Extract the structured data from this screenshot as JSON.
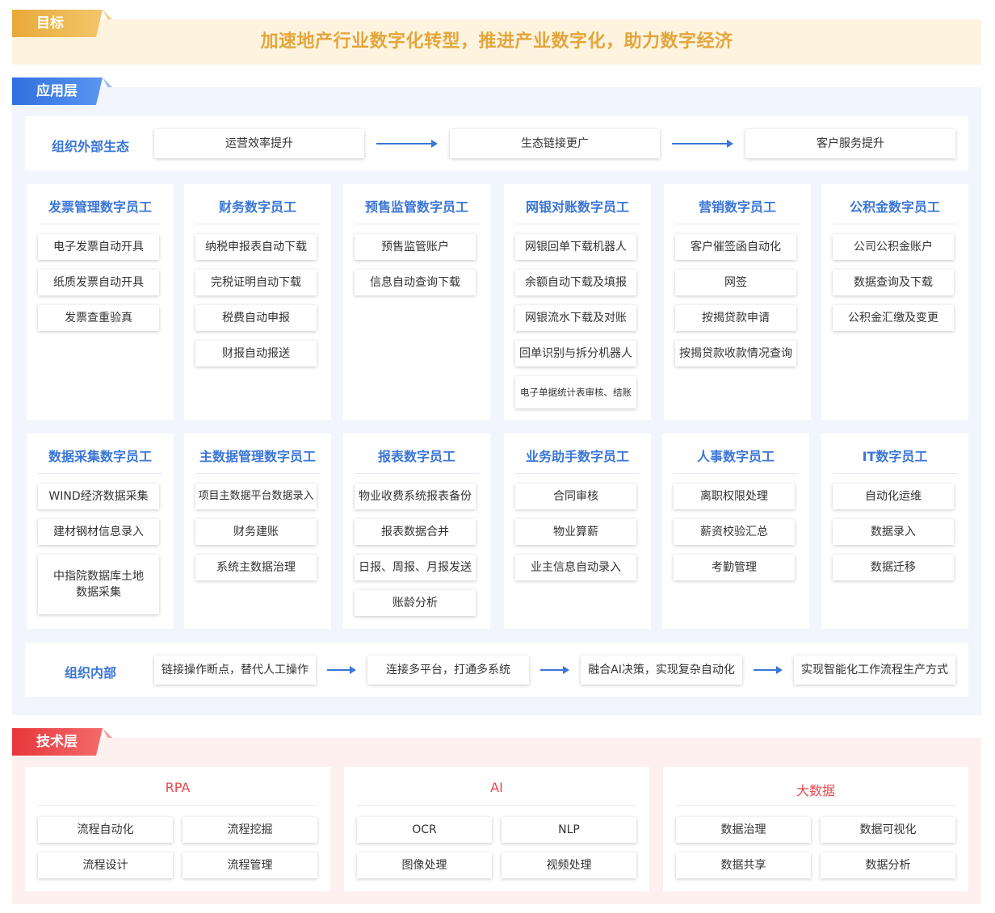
{
  "goal": {
    "tag": "目标",
    "text": "加速地产行业数字化转型，推进产业数字化，助力数字经济"
  },
  "app_layer": {
    "tag": "应用层",
    "external": {
      "title": "组织外部生态",
      "steps": [
        "运营效率提升",
        "生态链接更广",
        "客户服务提升"
      ]
    },
    "cards_row1": [
      {
        "title": "发票管理数字员工",
        "items": [
          "电子发票自动开具",
          "纸质发票自动开具",
          "发票查重验真"
        ]
      },
      {
        "title": "财务数字员工",
        "items": [
          "纳税申报表自动下载",
          "完税证明自动下载",
          "税费自动申报",
          "财报自动报送"
        ]
      },
      {
        "title": "预售监管数字员工",
        "items": [
          "预售监管账户",
          "信息自动查询下载"
        ]
      },
      {
        "title": "网银对账数字员工",
        "items": [
          "网银回单下载机器人",
          "余额自动下载及填报",
          "网银流水下载及对账",
          "回单识别与拆分机器人",
          "电子单据统计表审核、结账"
        ]
      },
      {
        "title": "营销数字员工",
        "items": [
          "客户催签函自动化",
          "网签",
          "按揭贷款申请",
          "按揭贷款收款情况查询"
        ]
      },
      {
        "title": "公积金数字员工",
        "items": [
          "公司公积金账户",
          "数据查询及下载",
          "公积金汇缴及变更"
        ]
      }
    ],
    "cards_row2": [
      {
        "title": "数据采集数字员工",
        "items": [
          "WIND经济数据采集",
          "建材钢材信息录入",
          "中指院数据库土地数据采集"
        ]
      },
      {
        "title": "主数据管理数字员工",
        "items": [
          "项目主数据平台数据录入",
          "财务建账",
          "系统主数据治理"
        ]
      },
      {
        "title": "报表数字员工",
        "items": [
          "物业收费系统报表备份",
          "报表数据合并",
          "日报、周报、月报发送",
          "账龄分析"
        ]
      },
      {
        "title": "业务助手数字员工",
        "items": [
          "合同审核",
          "物业算薪",
          "业主信息自动录入"
        ]
      },
      {
        "title": "人事数字员工",
        "items": [
          "离职权限处理",
          "薪资校验汇总",
          "考勤管理"
        ]
      },
      {
        "title": "IT数字员工",
        "items": [
          "自动化运维",
          "数据录入",
          "数据迁移"
        ]
      }
    ],
    "internal": {
      "title": "组织内部",
      "steps": [
        "链接操作断点，替代人工操作",
        "连接多平台，打通多系统",
        "融合AI决策，实现复杂自动化",
        "实现智能化工作流程生产方式"
      ]
    }
  },
  "tech_layer": {
    "tag": "技术层",
    "groups": [
      {
        "title": "RPA",
        "items": [
          "流程自动化",
          "流程挖掘",
          "流程设计",
          "流程管理"
        ]
      },
      {
        "title": "AI",
        "items": [
          "OCR",
          "NLP",
          "图像处理",
          "视频处理"
        ]
      },
      {
        "title": "大数据",
        "items": [
          "数据治理",
          "数据可视化",
          "数据共享",
          "数据分析"
        ]
      }
    ]
  },
  "colors": {
    "goal_accent": "#e4a53b",
    "app_accent": "#3a76d8",
    "tech_accent": "#e8474c"
  }
}
